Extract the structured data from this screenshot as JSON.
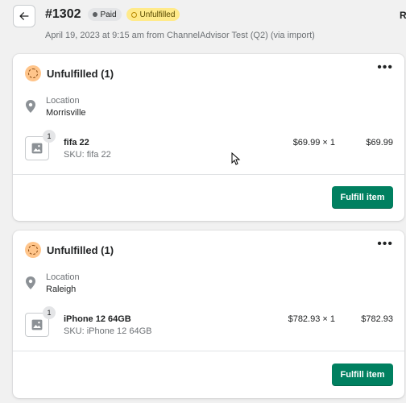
{
  "header": {
    "order_number": "#1302",
    "badges": {
      "paid": "Paid",
      "unfulfilled": "Unfulfilled"
    },
    "subtitle": "April 19, 2023 at 9:15 am from ChannelAdvisor Test (Q2) (via import)",
    "right_truncated": "R"
  },
  "fulfillments": [
    {
      "title": "Unfulfilled (1)",
      "location_label": "Location",
      "location": "Morrisville",
      "item": {
        "qty": "1",
        "name": "fifa 22",
        "sku": "SKU: fifa 22",
        "price": "$69.99 × 1",
        "total": "$69.99"
      },
      "button": "Fulfill item"
    },
    {
      "title": "Unfulfilled (1)",
      "location_label": "Location",
      "location": "Raleigh",
      "item": {
        "qty": "1",
        "name": "iPhone 12 64GB",
        "sku": "SKU: iPhone 12 64GB",
        "price": "$782.93 × 1",
        "total": "$782.93"
      },
      "button": "Fulfill item"
    }
  ],
  "icons": {
    "back": "arrow-left-icon",
    "status": "unfulfilled-status-icon",
    "menu": "more-horizontal-icon",
    "location": "location-pin-icon",
    "thumbnail": "image-placeholder-icon"
  },
  "colors": {
    "primary_button": "#008060",
    "unfulfilled_badge": "#ffea8a",
    "status_icon_bg": "#ffc58b",
    "paid_badge": "#e4e5e7"
  }
}
